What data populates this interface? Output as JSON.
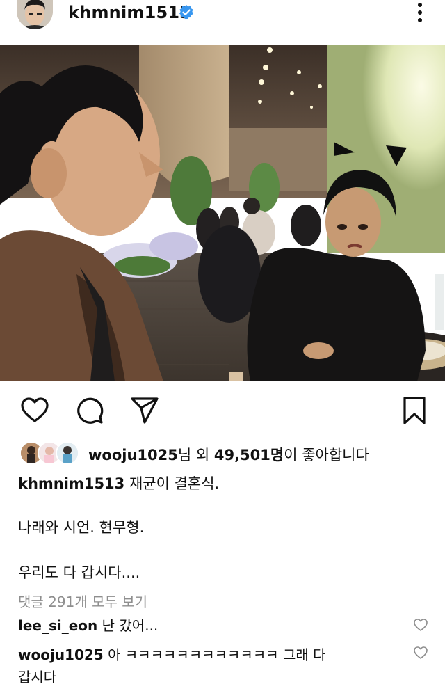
{
  "header": {
    "username": "khmnim1513",
    "more_icon": "more-vertical-icon",
    "verified_icon": "verified-badge-icon"
  },
  "actions": {
    "like_icon": "heart-icon",
    "comment_icon": "comment-icon",
    "share_icon": "send-icon",
    "save_icon": "bookmark-icon"
  },
  "likes": {
    "user": "wooju1025",
    "mid": "님 외 ",
    "count": "49,501명",
    "tail": "이 좋아합니다"
  },
  "caption": {
    "author": "khmnim1513",
    "line1": " 재균이 결혼식.",
    "line2": "나래와 시언. 현무형.",
    "line3": "우리도 다 갑시다...."
  },
  "view_all_comments": "댓글 291개 모두 보기",
  "comments": [
    {
      "user": "lee_si_eon",
      "text": " 난 갔어..."
    },
    {
      "user": "wooju1025",
      "text": " 아 ㅋㅋㅋㅋㅋㅋㅋㅋㅋㅋㅋㅋ 그래 다",
      "text2": "갑시다"
    }
  ],
  "colors": {
    "verified": "#3897f0",
    "secondary_text": "#8e8e8e",
    "primary_text": "#111111"
  }
}
